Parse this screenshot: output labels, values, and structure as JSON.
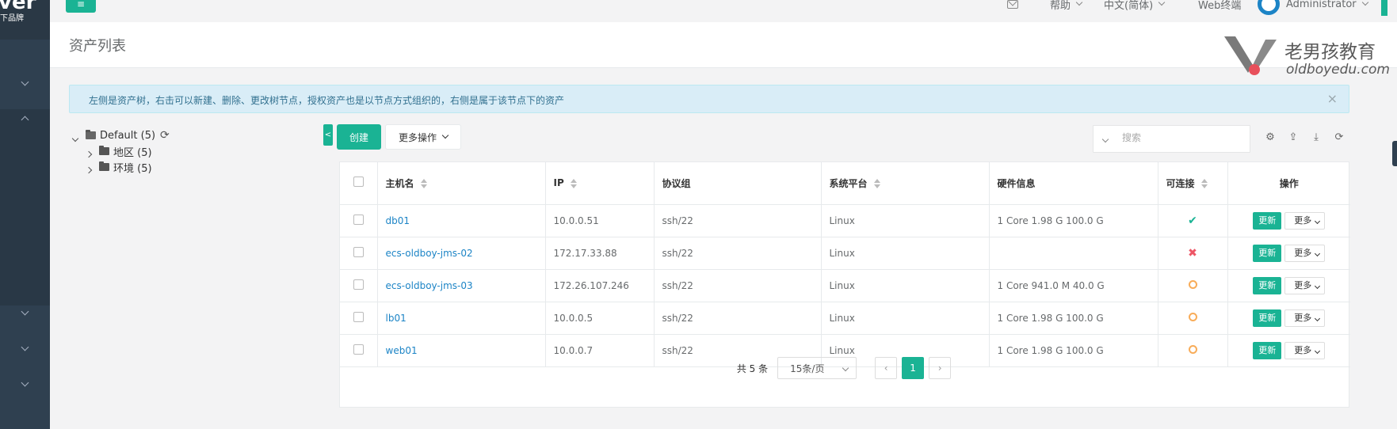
{
  "brand": {
    "logo_big": "ver",
    "logo_small": "下品牌"
  },
  "topnav": {
    "help": "帮助",
    "language": "中文(简体)",
    "web_terminal": "Web终端",
    "user": "Administrator"
  },
  "page": {
    "title": "资产列表"
  },
  "watermark": {
    "cn": "老男孩教育",
    "en": "oldboyedu.com"
  },
  "alert": {
    "text": "左侧是资产树，右击可以新建、删除、更改树节点，授权资产也是以节点方式组织的，右侧是属于该节点下的资产",
    "close": "×"
  },
  "tree": {
    "root": {
      "label": "Default (5)"
    },
    "children": [
      {
        "label": "地区 (5)"
      },
      {
        "label": "环境 (5)"
      }
    ]
  },
  "toolbar": {
    "collapse": "<",
    "create": "创建",
    "more_actions": "更多操作",
    "search_placeholder": "搜索"
  },
  "table": {
    "headers": [
      "主机名",
      "IP",
      "协议组",
      "系统平台",
      "硬件信息",
      "可连接",
      "操作"
    ],
    "rows": [
      {
        "hostname": "db01",
        "ip": "10.0.0.51",
        "protocol": "ssh/22",
        "platform": "Linux",
        "hardware": "1 Core 1.98 G 100.0 G",
        "status": "ok",
        "status_glyph": "✔"
      },
      {
        "hostname": "ecs-oldboy-jms-02",
        "ip": "172.17.33.88",
        "protocol": "ssh/22",
        "platform": "Linux",
        "hardware": "",
        "status": "failed",
        "status_glyph": "✖"
      },
      {
        "hostname": "ecs-oldboy-jms-03",
        "ip": "172.26.107.246",
        "protocol": "ssh/22",
        "platform": "Linux",
        "hardware": "1 Core 941.0 M 40.0 G",
        "status": "unknown",
        "status_glyph": ""
      },
      {
        "hostname": "lb01",
        "ip": "10.0.0.5",
        "protocol": "ssh/22",
        "platform": "Linux",
        "hardware": "1 Core 1.98 G 100.0 G",
        "status": "unknown",
        "status_glyph": ""
      },
      {
        "hostname": "web01",
        "ip": "10.0.0.7",
        "protocol": "ssh/22",
        "platform": "Linux",
        "hardware": "1 Core 1.98 G 100.0 G",
        "status": "unknown",
        "status_glyph": ""
      }
    ],
    "row_actions": {
      "update": "更新",
      "more": "更多"
    }
  },
  "pagination": {
    "total": "共 5 条",
    "page_size": "15条/页",
    "prev": "‹",
    "current": "1",
    "next": "›"
  },
  "colors": {
    "accent": "#1ab394",
    "sidebar": "#2f4050",
    "link": "#1c84c6",
    "danger": "#ed5565",
    "warning": "#f8ac59"
  },
  "icons": [
    "menu-icon",
    "mail-icon",
    "settings-icon",
    "upload-icon",
    "download-icon",
    "refresh-icon",
    "folder-icon",
    "chevron-down-icon"
  ]
}
